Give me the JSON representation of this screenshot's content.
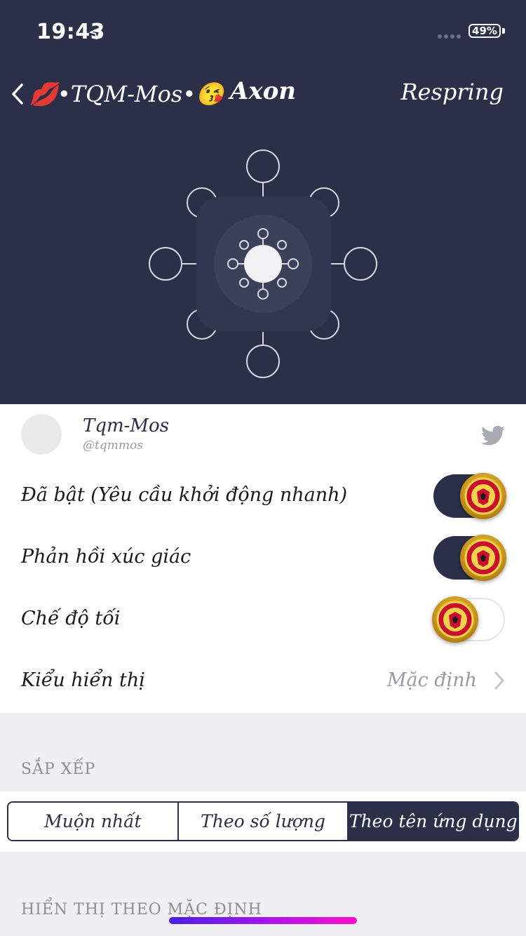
{
  "status_bar": {
    "time": "19:43",
    "battery": "49%",
    "battery_level": 0.49
  },
  "nav": {
    "back_label": "💋•TQM-Mos•😘",
    "title": "Axon",
    "right_button": "Respring"
  },
  "profile": {
    "name": "Tqm-Mos",
    "handle": "@tqmmos"
  },
  "settings": [
    {
      "label": "Đã bật (Yêu cầu khởi động nhanh)",
      "on": true
    },
    {
      "label": "Phản hồi xúc giác",
      "on": true
    },
    {
      "label": "Chế độ tối",
      "on": false
    }
  ],
  "display_style": {
    "label": "Kiểu hiển thị",
    "value": "Mặc định"
  },
  "sort_section": {
    "header": "SẮP XẾP",
    "options": [
      "Muộn nhất",
      "Theo số lượng",
      "Theo tên ứng dụng"
    ],
    "selected_index": 2
  },
  "default_section": {
    "header": "HIỂN THỊ THEO MẶC ĐỊNH"
  },
  "colors": {
    "header_bg": "#2b2f47",
    "accent": "#2b2f47",
    "page_bg": "#efeff4"
  }
}
